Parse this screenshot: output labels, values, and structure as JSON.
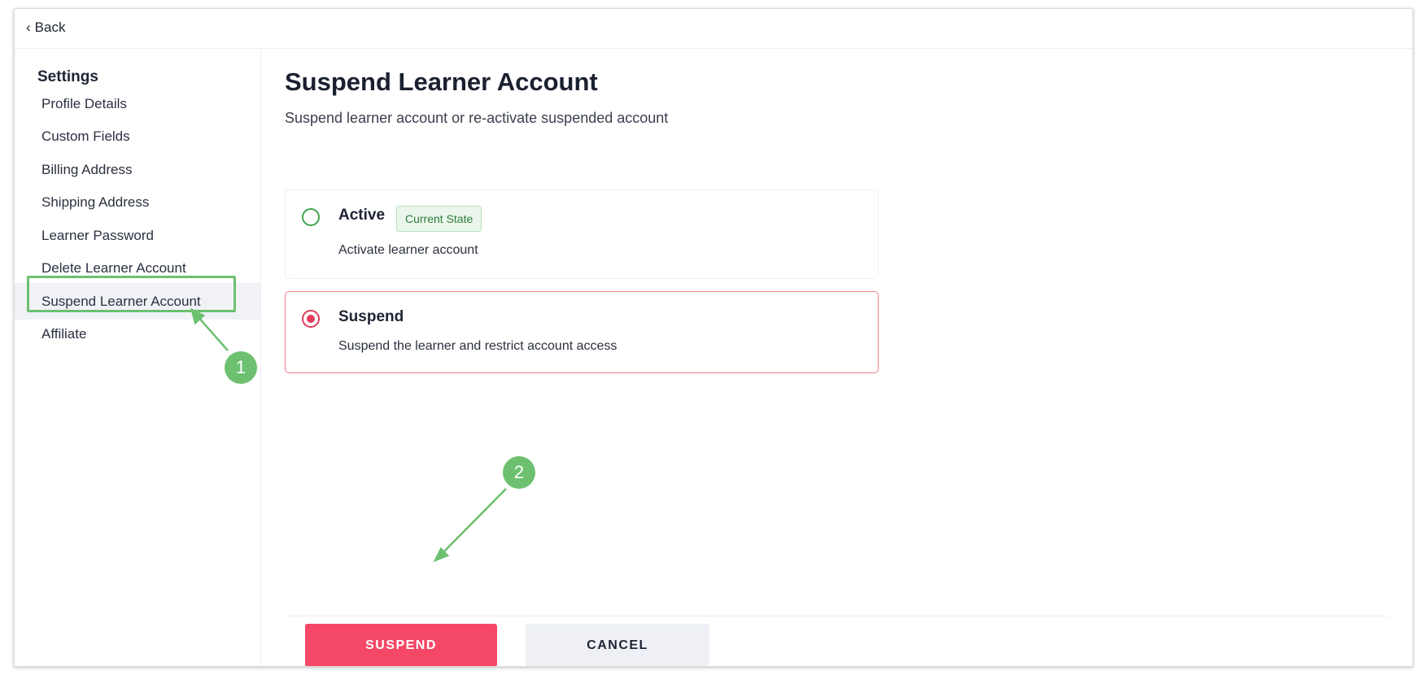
{
  "topbar": {
    "back_label": "Back"
  },
  "sidebar": {
    "title": "Settings",
    "items": [
      {
        "label": "Profile Details"
      },
      {
        "label": "Custom Fields"
      },
      {
        "label": "Billing Address"
      },
      {
        "label": "Shipping Address"
      },
      {
        "label": "Learner Password"
      },
      {
        "label": "Delete Learner Account"
      },
      {
        "label": "Suspend Learner Account",
        "active": true
      },
      {
        "label": "Affiliate"
      }
    ]
  },
  "main": {
    "title": "Suspend Learner Account",
    "subtitle": "Suspend learner account or re-activate suspended account",
    "options": [
      {
        "label": "Active",
        "badge": "Current State",
        "description": "Activate learner account",
        "selected": false
      },
      {
        "label": "Suspend",
        "description": "Suspend the learner and restrict account access",
        "selected": true
      }
    ],
    "buttons": {
      "suspend": "SUSPEND",
      "cancel": "CANCEL"
    }
  },
  "annotations": {
    "step1": "1",
    "step2": "2"
  },
  "colors": {
    "accent_red": "#f54867",
    "annotation_green": "#6cc06f",
    "active_radio": "#3fa34d",
    "suspend_radio": "#e23c5a"
  }
}
